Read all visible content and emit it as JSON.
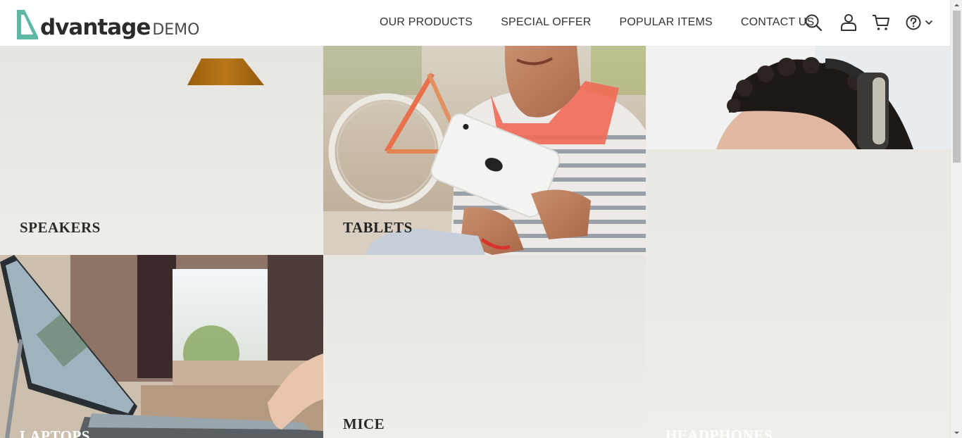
{
  "brand": {
    "word": "dvantage",
    "suffix": "DEMO",
    "accent_color": "#5fb7a6"
  },
  "nav": {
    "items": [
      {
        "label": "OUR PRODUCTS"
      },
      {
        "label": "SPECIAL OFFER"
      },
      {
        "label": "POPULAR ITEMS"
      },
      {
        "label": "CONTACT US"
      }
    ]
  },
  "header_icons": [
    "search-icon",
    "user-icon",
    "cart-icon",
    "help-icon",
    "chevron-down-icon"
  ],
  "categories": {
    "speakers": {
      "label": "SPEAKERS"
    },
    "tablets": {
      "label": "TABLETS"
    },
    "headphones": {
      "label": "HEADPHONES"
    },
    "laptops": {
      "label": "LAPTOPS"
    },
    "mice": {
      "label": "MICE"
    }
  }
}
